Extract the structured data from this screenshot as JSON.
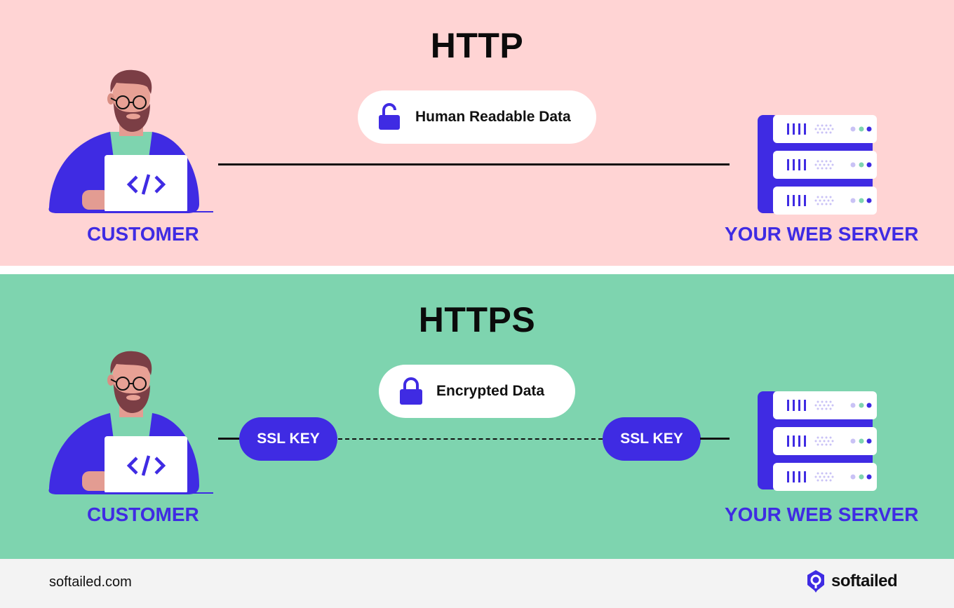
{
  "colors": {
    "http_bg": "#FFD4D4",
    "https_bg": "#7ED4AF",
    "accent": "#3F2BE3",
    "footer_bg": "#F3F3F3"
  },
  "http": {
    "title": "HTTP",
    "data_label": "Human Readable Data",
    "lock_icon": "lock-open-icon",
    "customer_label": "CUSTOMER",
    "server_label": "YOUR WEB SERVER",
    "connection": "solid"
  },
  "https": {
    "title": "HTTPS",
    "data_label": "Encrypted Data",
    "lock_icon": "lock-closed-icon",
    "ssl_key_left": "SSL KEY",
    "ssl_key_right": "SSL KEY",
    "customer_label": "CUSTOMER",
    "server_label": "YOUR WEB SERVER",
    "connection": "dashed"
  },
  "footer": {
    "url": "softailed.com",
    "brand": "softailed"
  }
}
